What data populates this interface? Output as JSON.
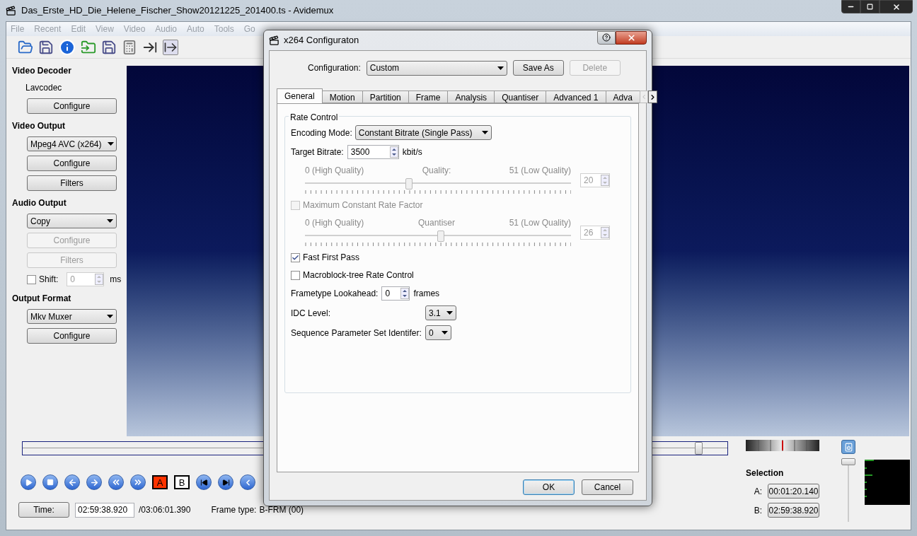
{
  "window": {
    "title": "Das_Erste_HD_Die_Helene_Fischer_Show20121225_201400.ts - Avidemux"
  },
  "menu": [
    "File",
    "Recent",
    "Edit",
    "View",
    "Video",
    "Audio",
    "Auto",
    "Tools",
    "Go"
  ],
  "sidebar": [
    {
      "heading": "Video Decoder",
      "items": [
        {
          "kind": "label",
          "text": "Lavcodec"
        },
        {
          "kind": "button",
          "label": "Configure",
          "disabled": false
        }
      ]
    },
    {
      "heading": "Video Output",
      "items": [
        {
          "kind": "select",
          "value": "Mpeg4 AVC (x264)"
        },
        {
          "kind": "button",
          "label": "Configure",
          "disabled": false
        },
        {
          "kind": "button",
          "label": "Filters",
          "disabled": false
        }
      ]
    },
    {
      "heading": "Audio Output",
      "items": [
        {
          "kind": "select",
          "value": "Copy"
        },
        {
          "kind": "button",
          "label": "Configure",
          "disabled": true
        },
        {
          "kind": "button",
          "label": "Filters",
          "disabled": true
        },
        {
          "kind": "shift",
          "label": "Shift:",
          "checked": false,
          "value": "0",
          "unit": "ms"
        }
      ]
    },
    {
      "heading": "Output Format",
      "items": [
        {
          "kind": "select",
          "value": "Mkv Muxer"
        },
        {
          "kind": "button",
          "label": "Configure",
          "disabled": false
        }
      ]
    }
  ],
  "timeline": {
    "level": 0.96
  },
  "markers": {
    "a": "A",
    "b": "B"
  },
  "time_bar": {
    "button": "Time:",
    "value": "02:59:38.920",
    "total": "/03:06:01.390",
    "frame_type_label": "Frame type:",
    "frame_type": "B-FRM (00)"
  },
  "selection": {
    "title": "Selection",
    "rows": [
      {
        "label": "A:",
        "value": "00:01:20.140"
      },
      {
        "label": "B:",
        "value": "02:59:38.920"
      }
    ]
  },
  "volume": {
    "level": 1
  },
  "dialog": {
    "title": "x264 Configuraton",
    "configuration_label": "Configuration:",
    "configuration_value": "Custom",
    "buttons": [
      {
        "label": "Save As",
        "disabled": false
      },
      {
        "label": "Delete",
        "disabled": true
      }
    ],
    "tabs": [
      {
        "label": "General",
        "selected": true
      },
      {
        "label": "Motion",
        "selected": false
      },
      {
        "label": "Partition",
        "selected": false
      },
      {
        "label": "Frame",
        "selected": false
      },
      {
        "label": "Analysis",
        "selected": false
      },
      {
        "label": "Quantiser",
        "selected": false
      },
      {
        "label": "Advanced 1",
        "selected": false
      },
      {
        "label": "Adva",
        "selected": false
      }
    ],
    "group_title": "Rate Control",
    "rows": [
      {
        "kind": "select",
        "label": "Encoding Mode:",
        "value": "Constant Bitrate (Single Pass)"
      },
      {
        "kind": "spin",
        "label": "Target Bitrate:",
        "value": "3500",
        "unit": "kbit/s"
      },
      {
        "kind": "slider",
        "left": "0 (High Quality)",
        "center": "Quality:",
        "right": "51 (Low Quality)",
        "level": 0.39,
        "value": "20",
        "disabled": true
      },
      {
        "kind": "checkbox",
        "label": "Maximum Constant Rate Factor",
        "checked": false,
        "disabled": true
      },
      {
        "kind": "slider",
        "left": "0 (High Quality)",
        "center": "Quantiser",
        "right": "51 (Low Quality)",
        "level": 0.51,
        "value": "26",
        "disabled": true
      },
      {
        "kind": "checkbox",
        "label": "Fast First Pass",
        "checked": true,
        "disabled": false
      },
      {
        "kind": "checkbox",
        "label": "Macroblock-tree Rate Control",
        "checked": false,
        "disabled": false
      },
      {
        "kind": "spin",
        "label": "Frametype Lookahead:",
        "value": "0",
        "unit": "frames"
      },
      {
        "kind": "aligned_select",
        "label": "IDC Level:",
        "value": "3.1"
      },
      {
        "kind": "aligned_select",
        "label": "Sequence Parameter Set Identifer:",
        "value": "0"
      }
    ],
    "footer": [
      "OK",
      "Cancel"
    ]
  }
}
